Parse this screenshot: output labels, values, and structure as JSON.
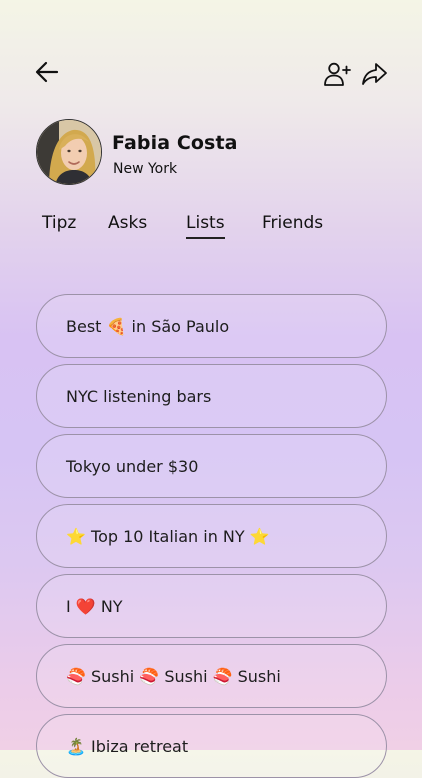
{
  "header": {
    "back_icon": "arrow-left-icon",
    "add_friend_icon": "add-user-icon",
    "share_icon": "share-arrow-icon"
  },
  "profile": {
    "name": "Fabia Costa",
    "location": "New York"
  },
  "tabs": [
    {
      "label": "Tipz",
      "active": false
    },
    {
      "label": "Asks",
      "active": false
    },
    {
      "label": "Lists",
      "active": true
    },
    {
      "label": "Friends",
      "active": false
    }
  ],
  "lists": [
    {
      "label": "Best 🍕 in São Paulo"
    },
    {
      "label": "NYC listening bars"
    },
    {
      "label": "Tokyo under $30"
    },
    {
      "label": "⭐ Top 10 Italian in NY ⭐"
    },
    {
      "label": "I ❤️ NY"
    },
    {
      "label": "🍣 Sushi 🍣 Sushi 🍣 Sushi"
    },
    {
      "label": "🏝️ Ibiza retreat"
    }
  ]
}
